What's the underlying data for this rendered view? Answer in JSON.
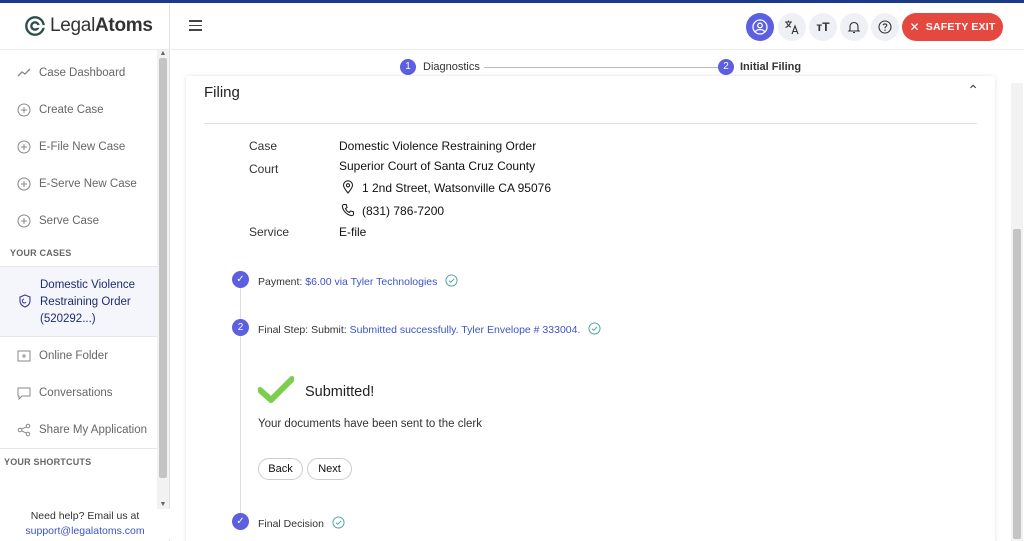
{
  "brand": {
    "name_prefix": "Legal",
    "name_suffix": "Atoms"
  },
  "sidebar": {
    "items": [
      {
        "label": "Case Dashboard",
        "icon": "chart-line-icon"
      },
      {
        "label": "Create Case",
        "icon": "plus-circle-icon"
      },
      {
        "label": "E-File New Case",
        "icon": "plus-circle-icon"
      },
      {
        "label": "E-Serve New Case",
        "icon": "plus-circle-icon"
      },
      {
        "label": "Serve Case",
        "icon": "plus-circle-icon"
      }
    ],
    "your_cases_heading": "YOUR CASES",
    "case": {
      "line1": "Domestic Violence",
      "line2": "Restraining Order",
      "line3": "(520292...)",
      "icon": "shield-icon"
    },
    "items2": [
      {
        "label": "Online Folder",
        "icon": "folder-plus-icon"
      },
      {
        "label": "Conversations",
        "icon": "chat-icon"
      },
      {
        "label": "Share My Application",
        "icon": "share-icon"
      }
    ],
    "shortcuts_heading": "YOUR SHORTCUTS",
    "help_text": "Need help? Email us at",
    "help_email": "support@legalatoms.com"
  },
  "header": {
    "safety_exit": "SAFETY EXIT",
    "text_size_label": "тT"
  },
  "stepper": {
    "steps": [
      {
        "number": "1",
        "label": "Diagnostics"
      },
      {
        "number": "2",
        "label": "Initial Filing"
      }
    ]
  },
  "filing": {
    "title": "Filing",
    "case_label": "Case",
    "case_value": "Domestic Violence Restraining Order",
    "court_label": "Court",
    "court_value": "Superior Court of Santa Cruz County",
    "address": "1 2nd Street, Watsonville CA 95076",
    "phone": "(831) 786-7200",
    "service_label": "Service",
    "service_value": "E-file",
    "payment_label": "Payment:",
    "payment_value": "$6.00 via Tyler Technologies",
    "final_step_number": "2",
    "final_step_label": "Final Step: Submit:",
    "final_step_value": "Submitted successfully. Tyler Envelope # 333004.",
    "submitted_title": "Submitted!",
    "submitted_message": "Your documents have been sent to the clerk",
    "back_label": "Back",
    "next_label": "Next",
    "final_decision_label": "Final Decision"
  },
  "colors": {
    "accent": "#5b5fe0",
    "danger": "#e5483f",
    "link": "#3d54c6",
    "success": "#7ccf4e"
  }
}
